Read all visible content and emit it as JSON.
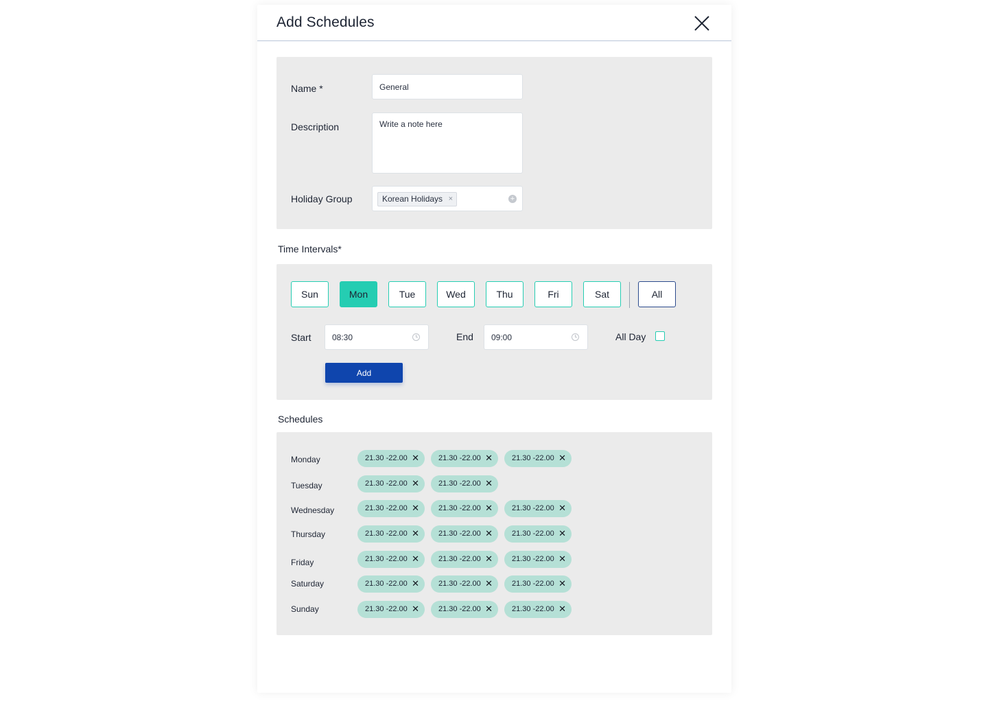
{
  "modal": {
    "title": "Add Schedules",
    "close_icon": "close-icon"
  },
  "general": {
    "name_label": "Name *",
    "name_value": "General",
    "description_label": "Description",
    "description_placeholder": "Write a note here",
    "holiday_label": "Holiday Group",
    "holiday_chip": "Korean Holidays",
    "holiday_chip_remove": "×",
    "holiday_add_icon": "+"
  },
  "time_intervals": {
    "heading": "Time Intervals*",
    "days": [
      {
        "label": "Sun",
        "active": false
      },
      {
        "label": "Mon",
        "active": true
      },
      {
        "label": "Tue",
        "active": false
      },
      {
        "label": "Wed",
        "active": false
      },
      {
        "label": "Thu",
        "active": false
      },
      {
        "label": "Fri",
        "active": false
      },
      {
        "label": "Sat",
        "active": false
      }
    ],
    "all_label": "All",
    "start_label": "Start",
    "start_value": "08:30",
    "end_label": "End",
    "end_value": "09:00",
    "all_day_label": "All Day",
    "all_day_checked": false,
    "add_label": "Add"
  },
  "schedules": {
    "heading": "Schedules",
    "remove_glyph": "✕",
    "rows": [
      {
        "day": "Monday",
        "slots": [
          "21.30 -22.00",
          "21.30 -22.00",
          "21.30 -22.00"
        ]
      },
      {
        "day": "Tuesday",
        "slots": [
          "21.30 -22.00",
          "21.30 -22.00"
        ]
      },
      {
        "day": "Wednesday",
        "slots": [
          "21.30 -22.00",
          "21.30 -22.00",
          "21.30 -22.00"
        ]
      },
      {
        "day": "Thursday",
        "slots": [
          "21.30 -22.00",
          "21.30 -22.00",
          "21.30 -22.00"
        ]
      },
      {
        "day": "Friday",
        "slots": [
          "21.30 -22.00",
          "21.30 -22.00",
          "21.30 -22.00"
        ]
      },
      {
        "day": "Saturday",
        "slots": [
          "21.30 -22.00",
          "21.30 -22.00",
          "21.30 -22.00"
        ]
      },
      {
        "day": "Sunday",
        "slots": [
          "21.30 -22.00",
          "21.30 -22.00",
          "21.30 -22.00"
        ]
      }
    ]
  },
  "colors": {
    "accent": "#25cdb2",
    "primary": "#0f45ad",
    "chip": "#b5e0d6",
    "panel": "#ebebeb"
  }
}
